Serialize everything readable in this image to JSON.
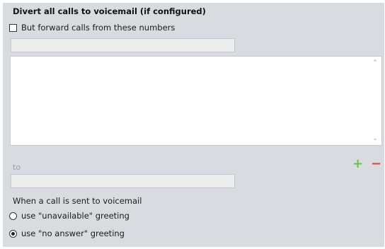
{
  "section_title": "Divert all calls to voicemail (if configured)",
  "forward_checkbox": {
    "label": "But forward calls from these numbers",
    "checked": false
  },
  "number_input": {
    "value": "",
    "placeholder": ""
  },
  "to_label": "to",
  "to_input": {
    "value": "",
    "placeholder": ""
  },
  "add_icon": "+",
  "remove_icon": "−",
  "voicemail_label": "When a call is sent to voicemail",
  "greeting_options": [
    {
      "label": "use \"unavailable\" greeting",
      "selected": false
    },
    {
      "label": "use \"no answer\" greeting",
      "selected": true
    }
  ],
  "colors": {
    "add": "#6cc24a",
    "remove": "#e0443a",
    "panel_bg": "#d8dce0"
  },
  "icons": {
    "scroll_up": "chevron-up-icon",
    "scroll_down": "chevron-down-icon"
  }
}
